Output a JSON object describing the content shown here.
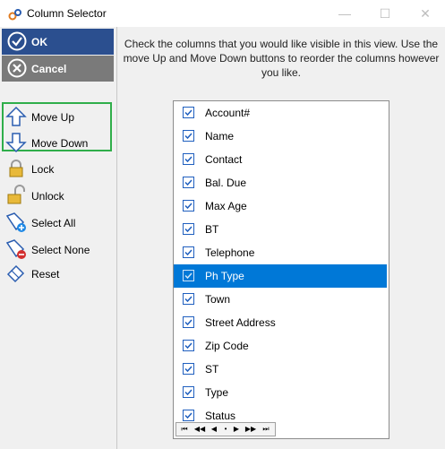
{
  "window": {
    "title": "Column Selector",
    "controls": {
      "minimize_icon": "minimize-icon",
      "maximize_icon": "maximize-icon",
      "close_icon": "close-icon"
    }
  },
  "sidebar": {
    "ok_label": "OK",
    "cancel_label": "Cancel",
    "items": [
      {
        "label": "Move Up",
        "icon": "arrow-up-icon"
      },
      {
        "label": "Move Down",
        "icon": "arrow-down-icon"
      },
      {
        "label": "Lock",
        "icon": "lock-icon"
      },
      {
        "label": "Unlock",
        "icon": "unlock-icon"
      },
      {
        "label": "Select All",
        "icon": "tag-add-icon"
      },
      {
        "label": "Select None",
        "icon": "tag-remove-icon"
      },
      {
        "label": "Reset",
        "icon": "eraser-icon"
      }
    ]
  },
  "instructions": "Check the columns that you would like visible in this view. Use the move Up and Move Down buttons to reorder the columns however you like.",
  "columns": [
    {
      "label": "Account#",
      "checked": true
    },
    {
      "label": "Name",
      "checked": true
    },
    {
      "label": "Contact",
      "checked": true
    },
    {
      "label": "Bal. Due",
      "checked": true
    },
    {
      "label": "Max Age",
      "checked": true
    },
    {
      "label": "BT",
      "checked": true
    },
    {
      "label": "Telephone",
      "checked": true
    },
    {
      "label": "Ph Type",
      "checked": true,
      "selected": true
    },
    {
      "label": "Town",
      "checked": true
    },
    {
      "label": "Street Address",
      "checked": true
    },
    {
      "label": "Zip Code",
      "checked": true
    },
    {
      "label": "ST",
      "checked": true
    },
    {
      "label": "Type",
      "checked": true
    },
    {
      "label": "Status",
      "checked": true
    }
  ],
  "pager": {
    "first": "⏮",
    "prev_page": "◀◀",
    "prev": "◀",
    "sep": "•",
    "next": "▶",
    "next_page": "▶▶",
    "last": "⏭"
  },
  "colors": {
    "ok_bg": "#2b4f8f",
    "cancel_bg": "#7a7a7a",
    "selection": "#0078d7",
    "highlight": "#2fae4a"
  }
}
